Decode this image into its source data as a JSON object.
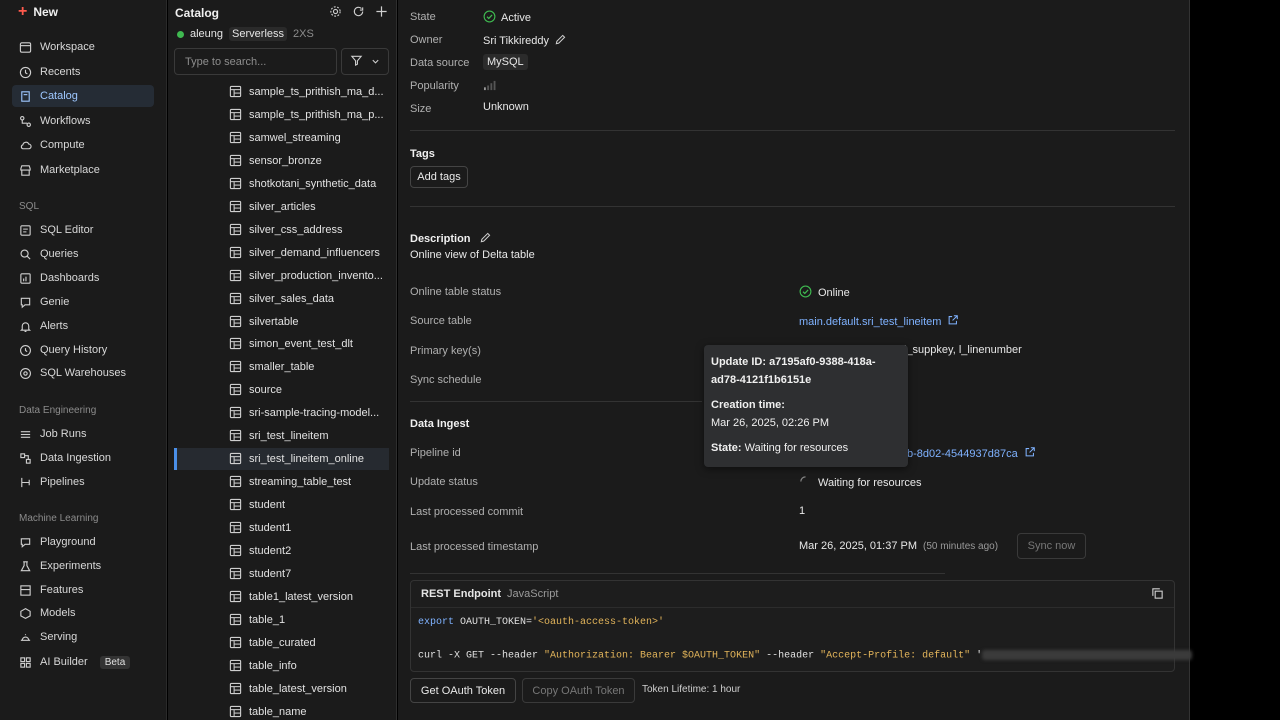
{
  "nav": {
    "new_label": "New",
    "items": [
      {
        "label": "Workspace",
        "icon": "workspace-icon"
      },
      {
        "label": "Recents",
        "icon": "clock-icon"
      },
      {
        "label": "Catalog",
        "icon": "catalog-icon"
      },
      {
        "label": "Workflows",
        "icon": "workflows-icon"
      },
      {
        "label": "Compute",
        "icon": "cloud-icon"
      },
      {
        "label": "Marketplace",
        "icon": "store-icon"
      }
    ],
    "sql_section": "SQL",
    "sql_items": [
      {
        "label": "SQL Editor"
      },
      {
        "label": "Queries"
      },
      {
        "label": "Dashboards"
      },
      {
        "label": "Genie"
      },
      {
        "label": "Alerts"
      },
      {
        "label": "Query History"
      },
      {
        "label": "SQL Warehouses"
      }
    ],
    "de_section": "Data Engineering",
    "de_items": [
      {
        "label": "Job Runs"
      },
      {
        "label": "Data Ingestion"
      },
      {
        "label": "Pipelines"
      }
    ],
    "ml_section": "Machine Learning",
    "ml_items": [
      {
        "label": "Playground"
      },
      {
        "label": "Experiments"
      },
      {
        "label": "Features"
      },
      {
        "label": "Models"
      },
      {
        "label": "Serving"
      },
      {
        "label": "AI Builder"
      }
    ],
    "beta_label": "Beta"
  },
  "catalog": {
    "title": "Catalog",
    "cluster_user": "aleung",
    "cluster_type": "Serverless",
    "cluster_size": "2XS",
    "search_placeholder": "Type to search...",
    "items": [
      "sample_ts_prithish_ma_d...",
      "sample_ts_prithish_ma_p...",
      "samwel_streaming",
      "sensor_bronze",
      "shotkotani_synthetic_data",
      "silver_articles",
      "silver_css_address",
      "silver_demand_influencers",
      "silver_production_invento...",
      "silver_sales_data",
      "silvertable",
      "simon_event_test_dlt",
      "smaller_table",
      "source",
      "sri-sample-tracing-model...",
      "sri_test_lineitem",
      "sri_test_lineitem_online",
      "streaming_table_test",
      "student",
      "student1",
      "student2",
      "student7",
      "table1_latest_version",
      "table_1",
      "table_curated",
      "table_info",
      "table_latest_version",
      "table_name"
    ]
  },
  "details": {
    "state_label": "State",
    "state_value": "Active",
    "owner_label": "Owner",
    "owner_value": "Sri Tikkireddy",
    "datasource_label": "Data source",
    "datasource_value": "MySQL",
    "popularity_label": "Popularity",
    "size_label": "Size",
    "size_value": "Unknown"
  },
  "tags": {
    "heading": "Tags",
    "add_label": "Add tags"
  },
  "description": {
    "heading": "Description",
    "text": "Online view of Delta table"
  },
  "online": {
    "status_label": "Online table status",
    "status_value": "Online",
    "source_label": "Source table",
    "source_value": "main.default.sri_test_lineitem",
    "pk_label": "Primary key(s)",
    "pk_value": "l_suppkey, l_linenumber",
    "sync_label": "Sync schedule"
  },
  "ingest": {
    "heading": "Data Ingest",
    "pipeline_label": "Pipeline id",
    "pipeline_value": "b-8d02-4544937d87ca",
    "update_label": "Update status",
    "update_value": "Waiting for resources",
    "commit_label": "Last processed commit",
    "commit_value": "1",
    "ts_label": "Last processed timestamp",
    "ts_value": "Mar 26, 2025, 01:37 PM",
    "ts_ago": "(50 minutes ago)",
    "sync_now": "Sync now"
  },
  "tooltip": {
    "update_id_label": "Update ID:",
    "update_id_value": "a7195af0-9388-418a-ad78-4121f1b6151e",
    "creation_label": "Creation time:",
    "creation_value": "Mar 26, 2025, 02:26 PM",
    "state_label": "State:",
    "state_value": "Waiting for resources"
  },
  "rest": {
    "heading": "REST Endpoint",
    "lang": "JavaScript",
    "line1_kw": "export",
    "line1_var": " OAUTH_TOKEN=",
    "line1_str": "'<oauth-access-token>'",
    "line2_cmd": "curl -X GET --header ",
    "line2_str1": "\"Authorization: Bearer $OAUTH_TOKEN\"",
    "line2_mid": " --header ",
    "line2_str2": "\"Accept-Profile: default\"",
    "line2_tail": " '",
    "get_token": "Get OAuth Token",
    "copy_token": "Copy OAuth Token",
    "lifetime": "Token Lifetime: 1 hour"
  }
}
